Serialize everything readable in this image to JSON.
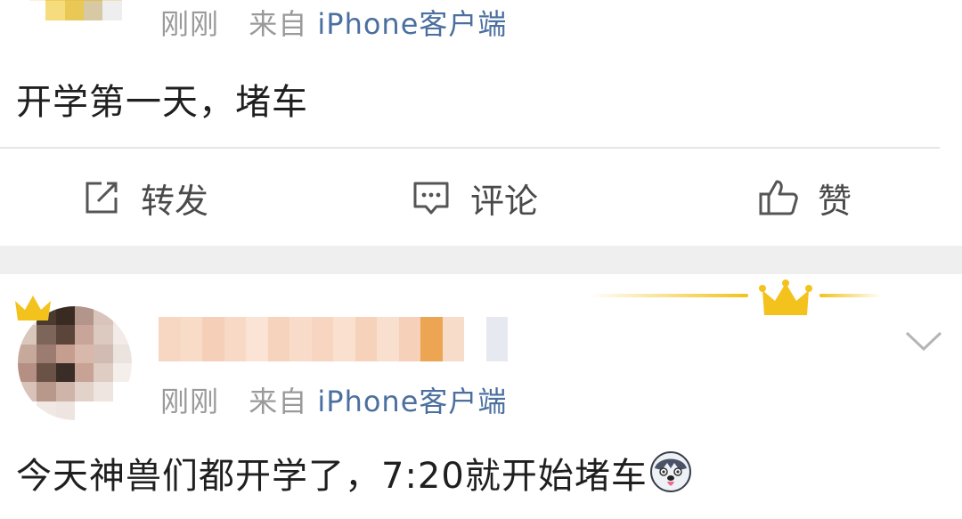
{
  "post1": {
    "time": "刚刚",
    "source_prefix": "来自",
    "source_link": "iPhone客户端",
    "text": "开学第一天，堵车",
    "actions": {
      "repost": "转发",
      "comment": "评论",
      "like": "赞"
    }
  },
  "post2": {
    "time": "刚刚",
    "source_prefix": "来自",
    "source_link": "iPhone客户端",
    "text": "今天神兽们都开学了，7:20就开始堵车"
  },
  "icons": {
    "repost": "share-edit-icon",
    "comment": "comment-bubble-icon",
    "like": "thumbs-up-icon",
    "menu": "chevron-down-icon",
    "crown": "crown-icon",
    "emoji": "husky-face-emoji"
  },
  "colors": {
    "link": "#4b6f9f",
    "meta_gray": "#9a9a9a",
    "band": "#efefef",
    "gold": "#f2c21b"
  }
}
